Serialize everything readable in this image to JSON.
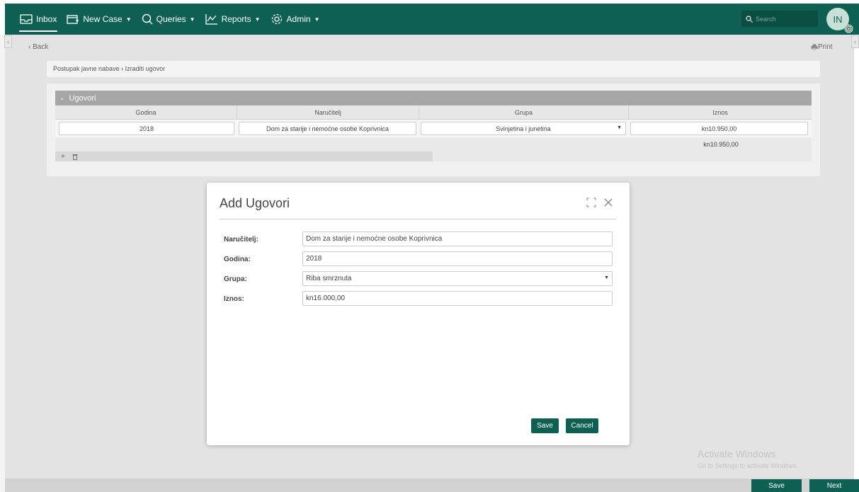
{
  "nav": {
    "inbox": "Inbox",
    "new_case": "New Case",
    "queries": "Queries",
    "reports": "Reports",
    "admin": "Admin"
  },
  "search": {
    "placeholder": "Search"
  },
  "user": {
    "initials": "IN"
  },
  "page": {
    "back_label": "Back",
    "print_label": "Print",
    "breadcrumb": "Postupak javne nabave › Izraditi ugovor"
  },
  "grid": {
    "section_title": "Ugovori",
    "columns": [
      "Godina",
      "Naručitelj",
      "Grupa",
      "Iznos"
    ],
    "rows": [
      {
        "godina": "2018",
        "narucitelj": "Dom za starije i nemoćne osobe Koprivnica",
        "grupa": "Svinjetina i junetina",
        "iznos": "kn10.950,00"
      }
    ],
    "total": "kn10.950,00"
  },
  "modal": {
    "title": "Add Ugovori",
    "fields": {
      "narucitelj": {
        "label": "Naručitelj:",
        "value": "Dom za starije i nemoćne osobe Koprivnica"
      },
      "godina": {
        "label": "Godina:",
        "value": "2018"
      },
      "grupa": {
        "label": "Grupa:",
        "value": "Riba smrznuta"
      },
      "iznos": {
        "label": "Iznos:",
        "value": "kn16.000,00"
      }
    },
    "save_label": "Save",
    "cancel_label": "Cancel"
  },
  "footer": {
    "save_label": "Save",
    "next_label": "Next"
  },
  "watermark": {
    "title": "Activate Windows",
    "subtitle": "Go to Settings to activate Windows."
  },
  "colors": {
    "brand": "#0e6152",
    "backdrop": "#e3e3e3"
  }
}
